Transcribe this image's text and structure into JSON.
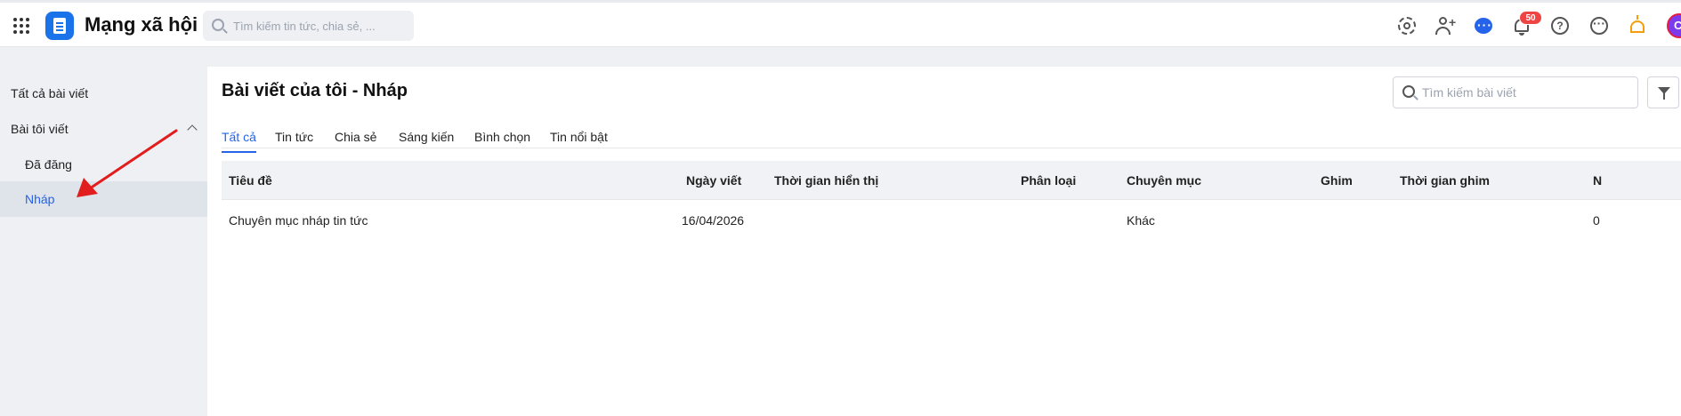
{
  "header": {
    "app_title": "Mạng xã hội",
    "search_placeholder": "Tìm kiếm tin tức, chia sẻ, ...",
    "notification_count": "50",
    "avatar_letter": "C",
    "icons": [
      "apps-grid-icon",
      "app-logo-icon",
      "search-icon",
      "gear-icon",
      "add-user-icon",
      "chat-icon",
      "bell-icon",
      "help-icon",
      "more-icon",
      "sun-icon"
    ]
  },
  "sidebar": {
    "all_posts": "Tất cả bài viết",
    "my_posts": "Bài tôi viết",
    "published": "Đã đăng",
    "draft": "Nháp"
  },
  "main": {
    "title": "Bài viết của tôi - Nháp",
    "search_placeholder": "Tìm kiếm bài viết",
    "tabs": [
      "Tất cả",
      "Tin tức",
      "Chia sẻ",
      "Sáng kiến",
      "Bình chọn",
      "Tin nổi bật"
    ],
    "active_tab": "Tất cả"
  },
  "table": {
    "columns": [
      "Tiêu đề",
      "Ngày viết",
      "Thời gian hiển thị",
      "Phân loại",
      "Chuyên mục",
      "Ghim",
      "Thời gian ghim",
      "N"
    ],
    "rows": [
      [
        "Chuyên mục nháp tin tức",
        "16/04/2026",
        "",
        "",
        "Khác",
        "",
        "",
        "0"
      ]
    ]
  },
  "colors": {
    "accent": "#2563eb",
    "badge": "#ef4444",
    "annotation": "#e11d1d",
    "sidebar_bg": "#eef0f4"
  }
}
